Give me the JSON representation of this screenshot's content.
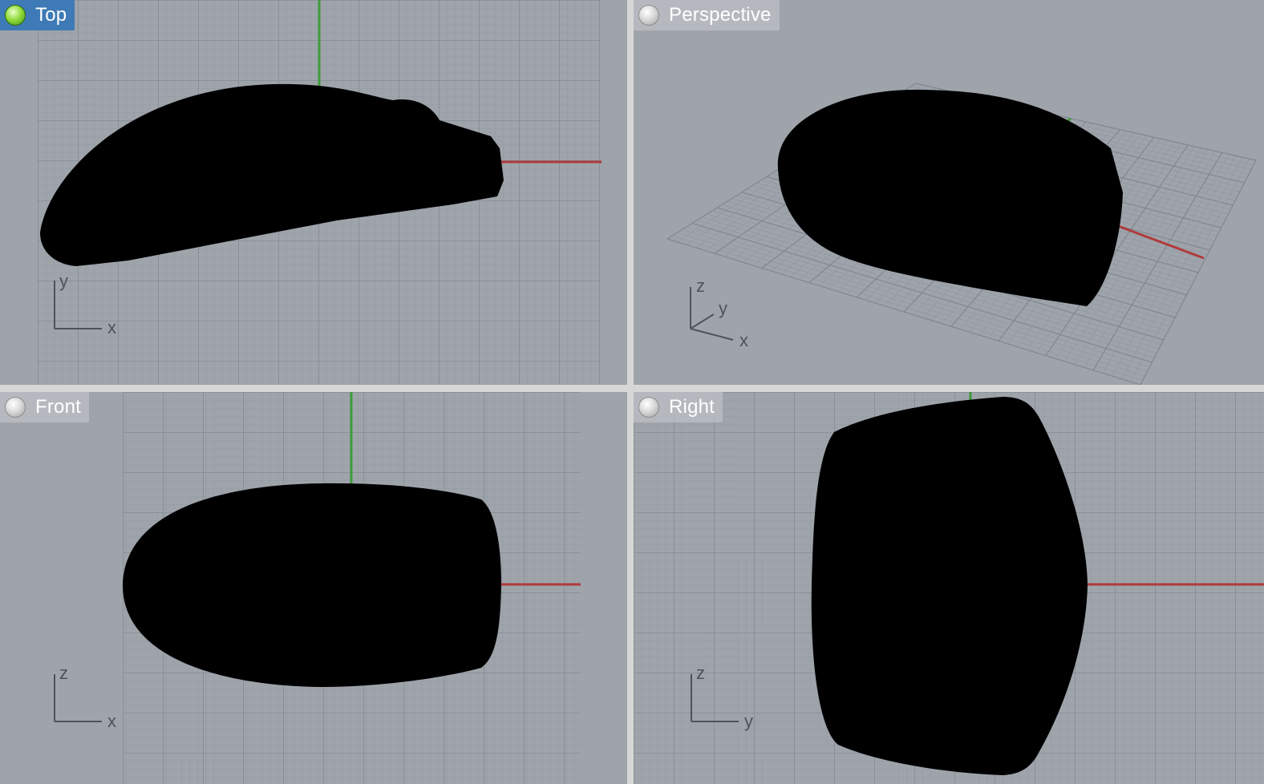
{
  "viewports": {
    "top": {
      "label": "Top",
      "active": true,
      "axis_a": "x",
      "axis_b": "y"
    },
    "perspective": {
      "label": "Perspective",
      "active": false,
      "axis_x": "x",
      "axis_y": "y",
      "axis_z": "z"
    },
    "front": {
      "label": "Front",
      "active": false,
      "axis_a": "x",
      "axis_b": "z"
    },
    "right": {
      "label": "Right",
      "active": false,
      "axis_a": "y",
      "axis_b": "z"
    }
  },
  "colors": {
    "viewport_bg": "#9fa4ab",
    "grid_minor": "#9199a2",
    "grid_major": "#7f8790",
    "axis_x": "#b03a3a",
    "axis_y": "#3f9a3a",
    "object": "#000000",
    "active_tab": "#3e7ab5"
  },
  "icons": {
    "viewport_indicator": "sphere-indicator-icon"
  }
}
